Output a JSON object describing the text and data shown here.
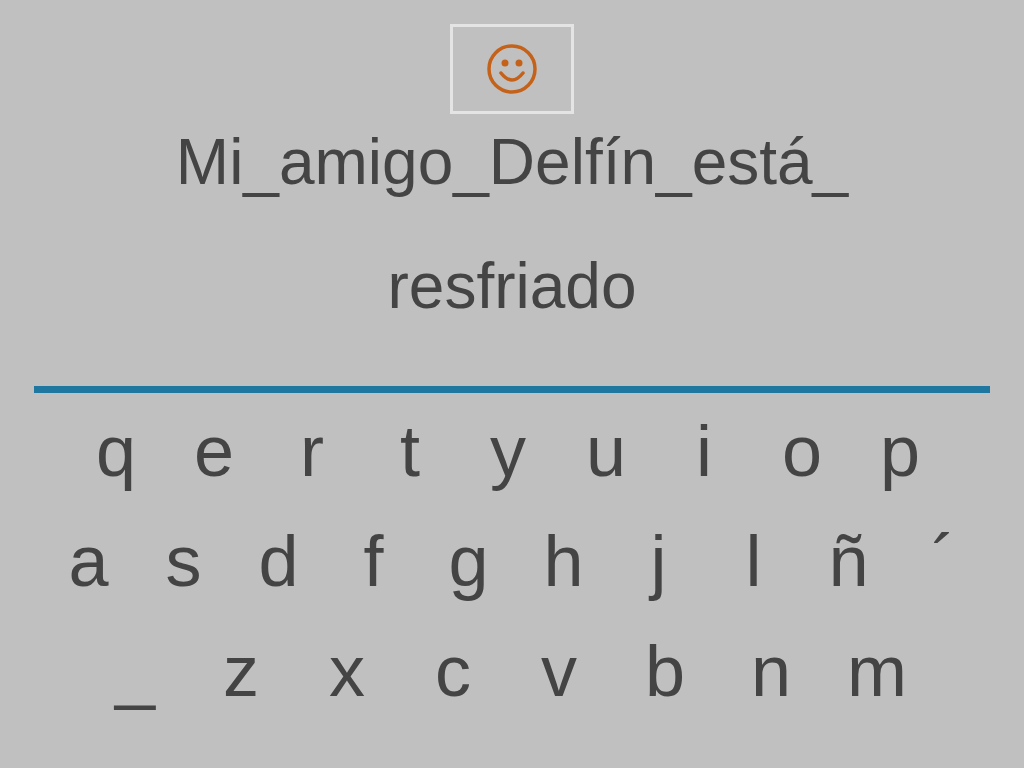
{
  "hint_button": {
    "kind": "smiley"
  },
  "sentence_lines": [
    "Mi_amigo_Delfín_está_",
    "resfriado"
  ],
  "keyboard_rows": [
    [
      "q",
      "e",
      "r",
      "t",
      "y",
      "u",
      "i",
      "o",
      "p"
    ],
    [
      "a",
      "s",
      "d",
      "f",
      "g",
      "h",
      "j",
      "l",
      "ñ",
      "´"
    ],
    [
      "_",
      "z",
      "x",
      "c",
      "v",
      "b",
      "n",
      "m"
    ]
  ]
}
